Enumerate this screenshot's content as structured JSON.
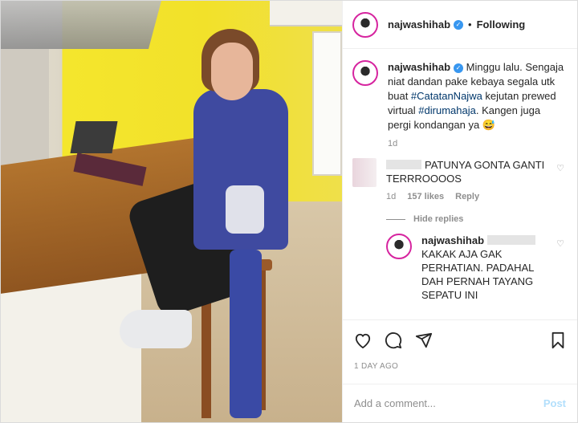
{
  "post": {
    "username": "najwashihab",
    "follow_status": "Following",
    "separator": "•"
  },
  "caption": {
    "username": "najwashihab",
    "text_1": "Minggu lalu. Sengaja niat dandan pake kebaya segala utk buat ",
    "tag_1": "#CatatanNajwa",
    "text_2": " kejutan prewed virtual ",
    "tag_2": "#dirumahaja",
    "text_3": ". Kangen juga pergi kondangan ya 😅",
    "age": "1d"
  },
  "comment": {
    "text": "PATUNYA GONTA GANTI TERRROOOOS",
    "age": "1d",
    "likes": "157 likes",
    "reply_label": "Reply"
  },
  "replies_toggle": "Hide replies",
  "reply": {
    "username": "najwashihab",
    "text": "KAKAK AJA GAK PERHATIAN. PADAHAL DAH PERNAH TAYANG SEPATU INI"
  },
  "post_date": "1 DAY AGO",
  "add_comment": {
    "placeholder": "Add a comment...",
    "post_label": "Post"
  },
  "icons": {
    "like": "heart-icon",
    "comment": "comment-icon",
    "share": "share-icon",
    "save": "bookmark-icon",
    "verified": "verified-badge-icon"
  },
  "colors": {
    "verified_blue": "#3897f0",
    "hashtag": "#00376b",
    "post_disabled": "#b2dffc",
    "avatar_ring": "#d6249f"
  }
}
